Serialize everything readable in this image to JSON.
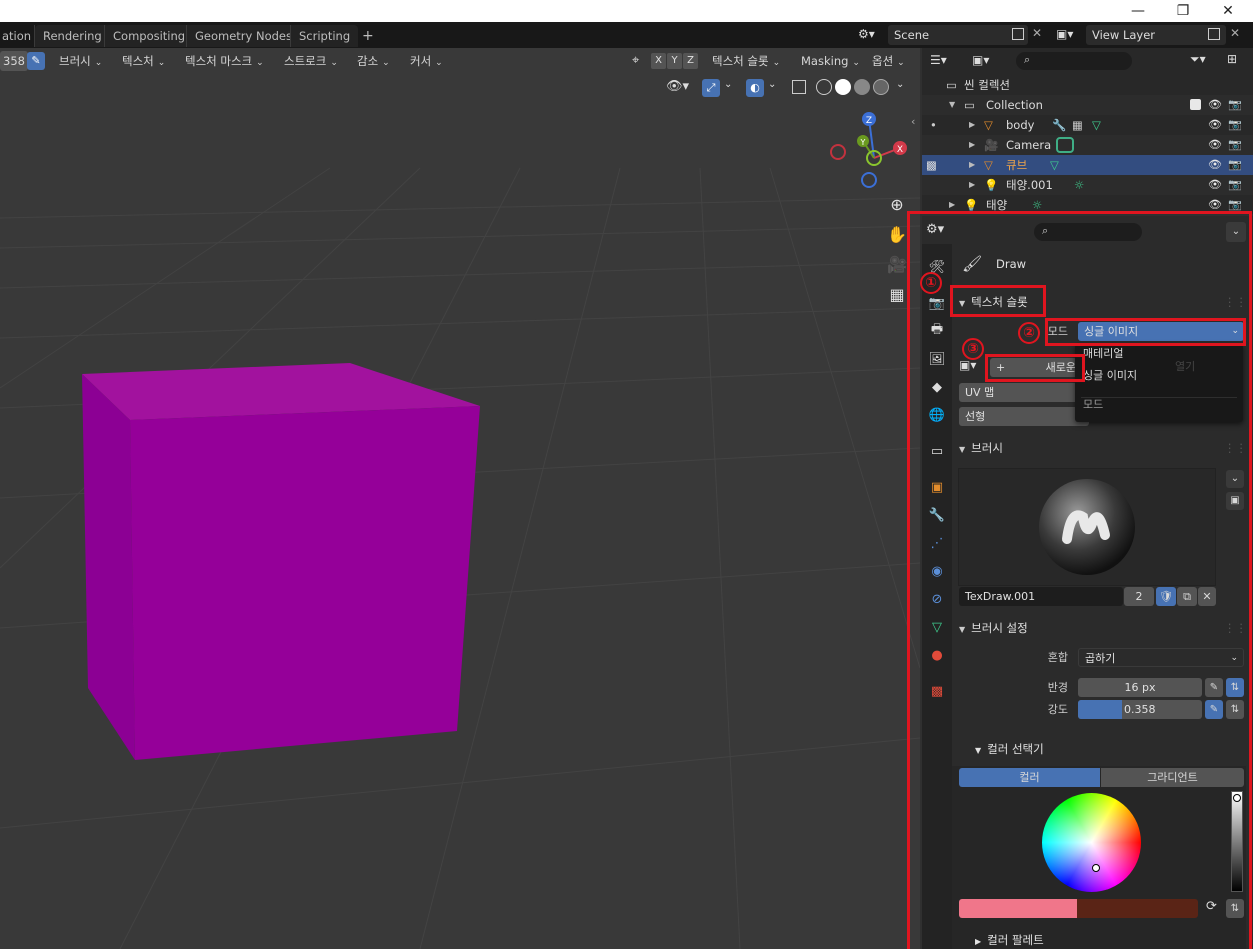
{
  "titlebar": {
    "minimize": "—",
    "restore": "❐",
    "close": "✕"
  },
  "topbar": {
    "tabs": [
      "ation",
      "Rendering",
      "Compositing",
      "Geometry Nodes",
      "Scripting"
    ],
    "add_tab": "+",
    "scene": "Scene",
    "view_layer": "View Layer"
  },
  "viewport_header": {
    "strength_stub": "358",
    "menus": [
      "브러시",
      "텍스처",
      "텍스처 마스크",
      "스트로크",
      "감소",
      "커서"
    ],
    "axes": [
      "X",
      "Y",
      "Z"
    ],
    "texture_slots": "텍스처 슬롯",
    "masking": "Masking",
    "options": "옵션"
  },
  "gizmo": {
    "z": "Z",
    "y": "Y",
    "x": "X"
  },
  "outliner": {
    "scene_collection": "씬 컬렉션",
    "collection": "Collection",
    "items": [
      {
        "name": "body"
      },
      {
        "name": "Camera"
      },
      {
        "name": "큐브"
      },
      {
        "name": "태양.001"
      },
      {
        "name": "태양"
      }
    ]
  },
  "properties": {
    "tool_name": "Draw",
    "texture_slots_panel": "텍스처 슬롯",
    "mode_label": "모드",
    "mode_value": "싱글 이미지",
    "new_button": "새로운",
    "uv_map": "UV 맵",
    "interpolation": "선형",
    "dropdown": {
      "items": [
        "매테리얼",
        "싱글 이미지"
      ],
      "title": "모드",
      "hidden_text": "열기"
    },
    "brush_panel": "브러시",
    "brush_name": "TexDraw.001",
    "brush_users": "2",
    "brush_settings_panel": "브러시 설정",
    "blend_label": "혼합",
    "blend_value": "곱하기",
    "radius_label": "반경",
    "radius_value": "16 px",
    "strength_label": "강도",
    "strength_value": "0.358",
    "strength_fraction": 0.358,
    "color_picker": "컬러 선택기",
    "color_tab": "컬러",
    "gradient_tab": "그라디언트",
    "palette": "컬러 팔레트"
  },
  "annotations": [
    "①",
    "②",
    "③"
  ],
  "colors": {
    "cube_front": "#93009a",
    "cube_top": "#a3109f",
    "cube_side": "#8a0093",
    "selection_blue": "#334d80",
    "annotation_red": "#e0151f",
    "brush_color": "#f0768a",
    "secondary_color": "#5a2416"
  }
}
